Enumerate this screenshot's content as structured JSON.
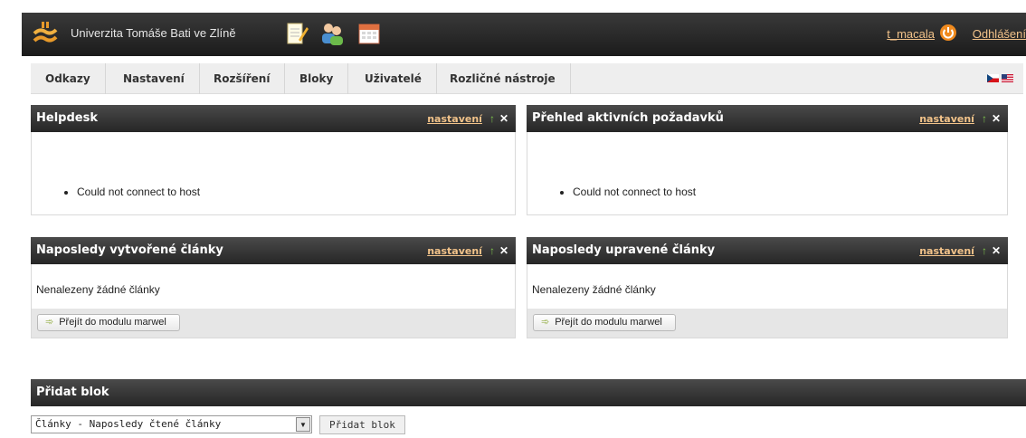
{
  "header": {
    "university": "Univerzita Tomáše Bati ve Zlíně",
    "username": "t_macala",
    "logout": "Odhlášení",
    "icons": [
      "logo-icon",
      "notepad-icon",
      "users-icon",
      "calendar-icon",
      "power-icon"
    ]
  },
  "menu": {
    "items": [
      "Odkazy",
      "Nastavení",
      "Rozšíření",
      "Bloky",
      "Uživatelé",
      "Rozličné nástroje"
    ],
    "flags": [
      "cz-flag-icon",
      "us-flag-icon"
    ]
  },
  "panels": {
    "helpdesk": {
      "title": "Helpdesk",
      "settings": "nastavení",
      "message": "Could not connect to host"
    },
    "active_requests": {
      "title": "Přehled aktivních požadavků",
      "settings": "nastavení",
      "message": "Could not connect to host"
    },
    "created_articles": {
      "title": "Naposledy vytvořené články",
      "settings": "nastavení",
      "text": "Nenalezeny žádné články",
      "button": "Přejít do modulu marwel"
    },
    "edited_articles": {
      "title": "Naposledy upravené články",
      "settings": "nastavení",
      "text": "Nenalezeny žádné články",
      "button": "Přejít do modulu marwel"
    }
  },
  "add_block": {
    "title": "Přidat blok",
    "selected": "Články - Naposledy čtené články",
    "button": "Přidat blok"
  },
  "colors": {
    "header_bg": "#262626",
    "link": "#f2c38a",
    "up_arrow": "#7cc04a"
  }
}
